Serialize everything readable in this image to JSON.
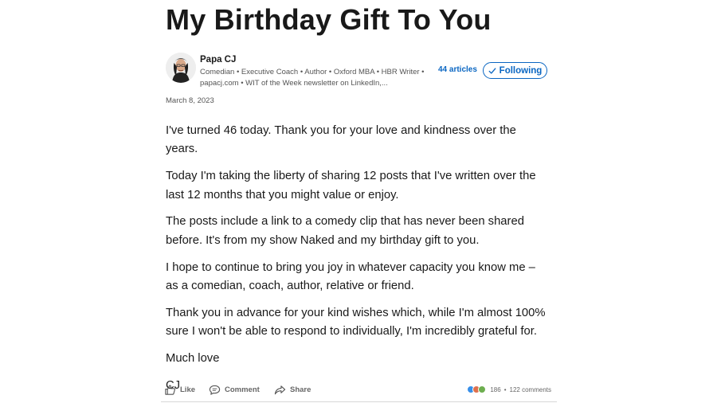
{
  "article": {
    "title": "My Birthday Gift To You",
    "date": "March 8, 2023",
    "paragraphs": [
      "I've turned 46 today. Thank you for your love and kindness over the years.",
      "Today I'm taking the liberty of sharing 12 posts that I've written over the last 12 months that you might value or enjoy.",
      "The posts include a link to a comedy clip that has never been shared before. It's from my show Naked and my birthday gift to you.",
      "I hope to continue to bring you joy in whatever capacity you know me – as a comedian, coach, author, relative or friend.",
      "Thank you in advance for your kind wishes which, while I'm almost 100% sure I won't be able to respond to individually, I'm incredibly grateful for.",
      "Much love",
      "CJ"
    ]
  },
  "author": {
    "name": "Papa CJ",
    "headline": "Comedian • Executive Coach • Author • Oxford MBA • HBR Writer • papacj.com • WIT of the Week newsletter on LinkedIn,...",
    "articles_label": "44 articles",
    "follow_label": "Following"
  },
  "actions": {
    "like": "Like",
    "comment": "Comment",
    "share": "Share",
    "reactions_count": "186",
    "separator": "•",
    "comments_count": "122 comments"
  },
  "colors": {
    "accent": "#0a66c2",
    "like_reaction": "#378fe9",
    "love_reaction": "#df704d",
    "celebrate_reaction": "#6dae4f"
  },
  "icons": {
    "follow": "checkmark-icon",
    "like": "thumbs-up-icon",
    "comment": "speech-bubble-icon",
    "share": "share-arrow-icon"
  }
}
